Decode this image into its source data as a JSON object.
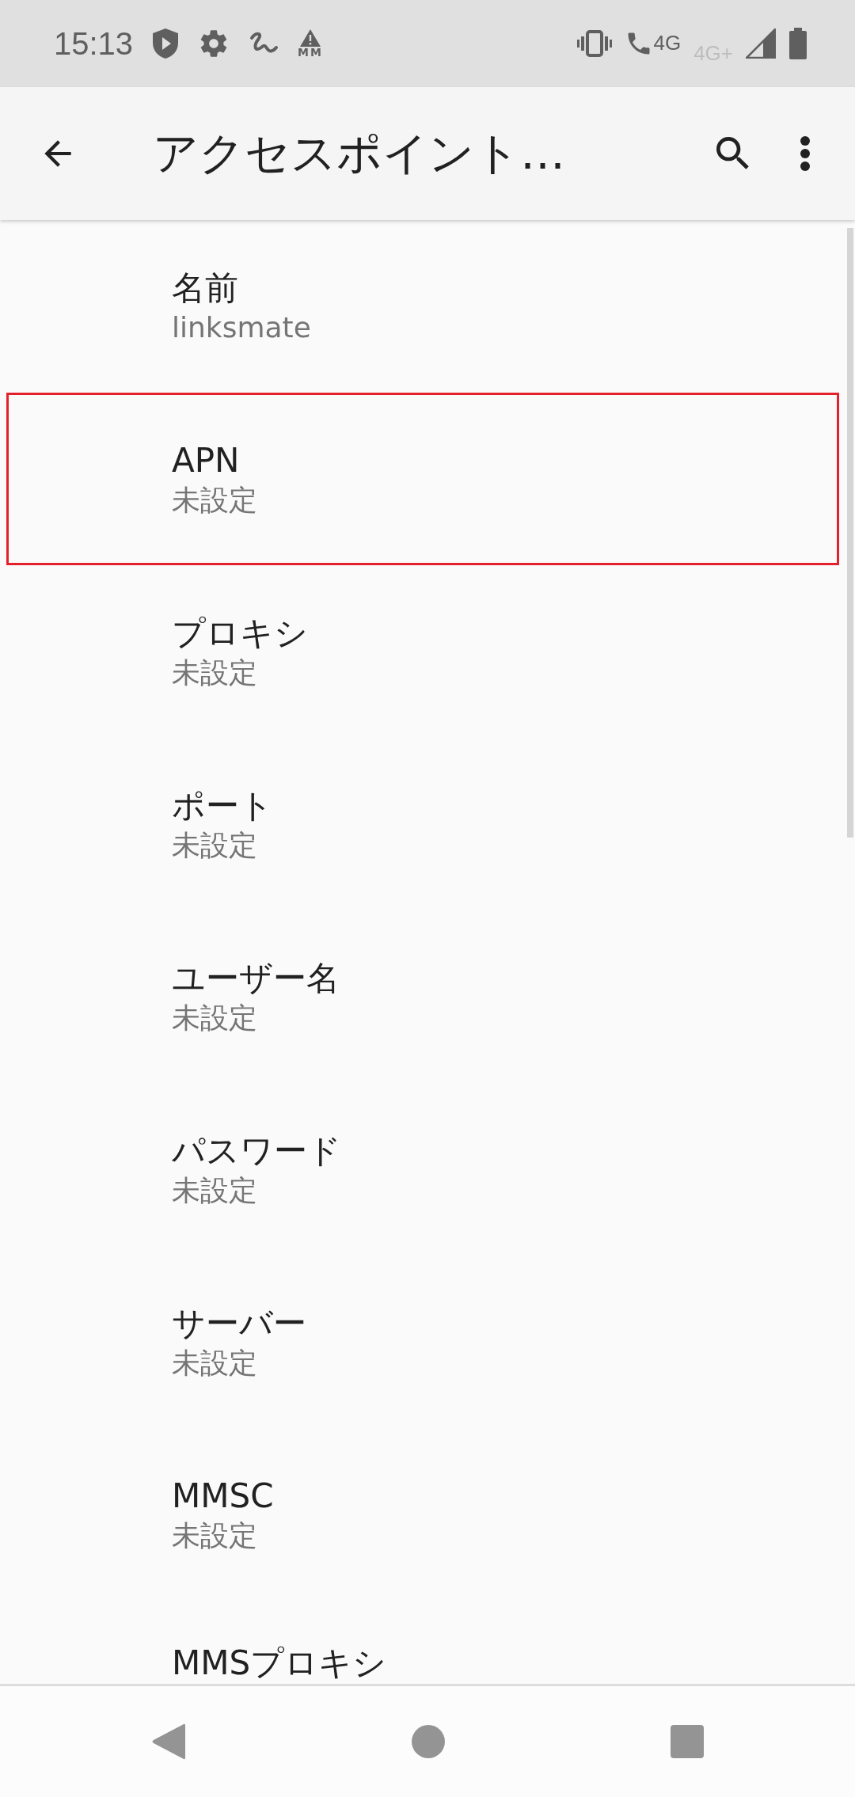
{
  "status_bar": {
    "time": "15:13",
    "warning_label": "MM",
    "network_primary": "4G",
    "network_secondary": "4G+"
  },
  "app_bar": {
    "title": "アクセスポイント…"
  },
  "items": [
    {
      "title": "名前",
      "summary": "linksmate",
      "highlighted": false
    },
    {
      "title": "APN",
      "summary": "未設定",
      "highlighted": true
    },
    {
      "title": "プロキシ",
      "summary": "未設定",
      "highlighted": false
    },
    {
      "title": "ポート",
      "summary": "未設定",
      "highlighted": false
    },
    {
      "title": "ユーザー名",
      "summary": "未設定",
      "highlighted": false
    },
    {
      "title": "パスワード",
      "summary": "未設定",
      "highlighted": false
    },
    {
      "title": "サーバー",
      "summary": "未設定",
      "highlighted": false
    },
    {
      "title": "MMSC",
      "summary": "未設定",
      "highlighted": false
    },
    {
      "title": "MMSプロキシ",
      "highlighted": false
    }
  ]
}
